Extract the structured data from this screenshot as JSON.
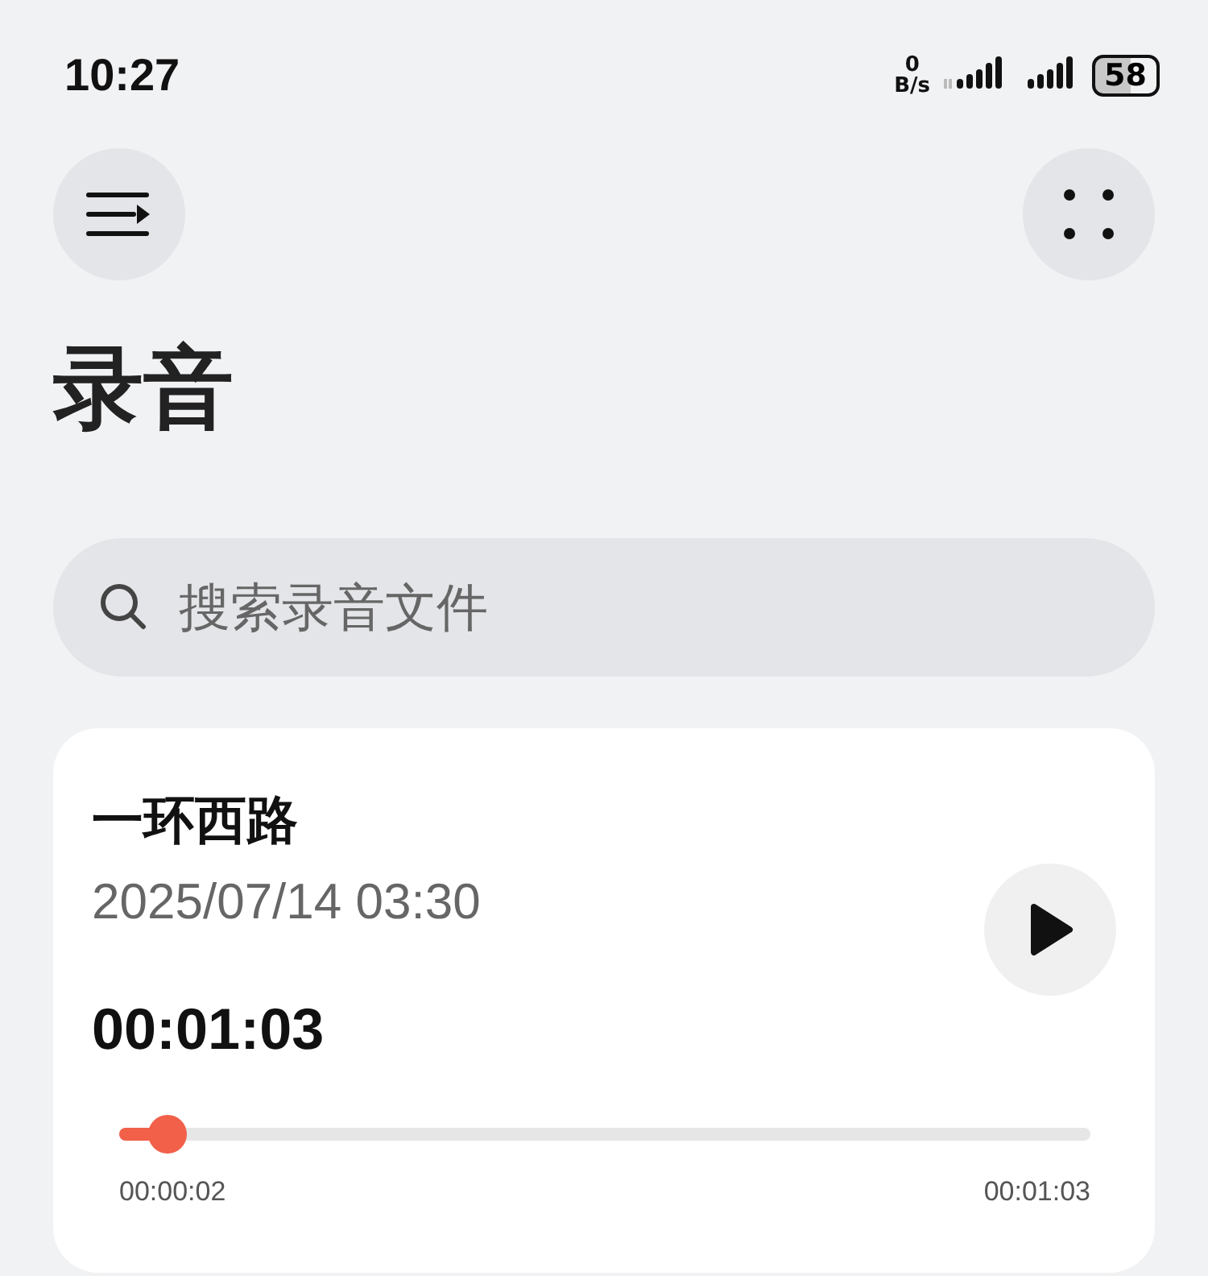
{
  "status_bar": {
    "time": "10:27",
    "net_speed_value": "0",
    "net_speed_unit": "B/s",
    "battery": "58"
  },
  "title": "录音",
  "search": {
    "placeholder": "搜索录音文件"
  },
  "recordings": [
    {
      "name": "一环西路",
      "date": "2025/07/14 03:30",
      "duration": "00:01:03",
      "level": 0.05,
      "position": "00:00:02",
      "total": "00:01:03"
    }
  ]
}
